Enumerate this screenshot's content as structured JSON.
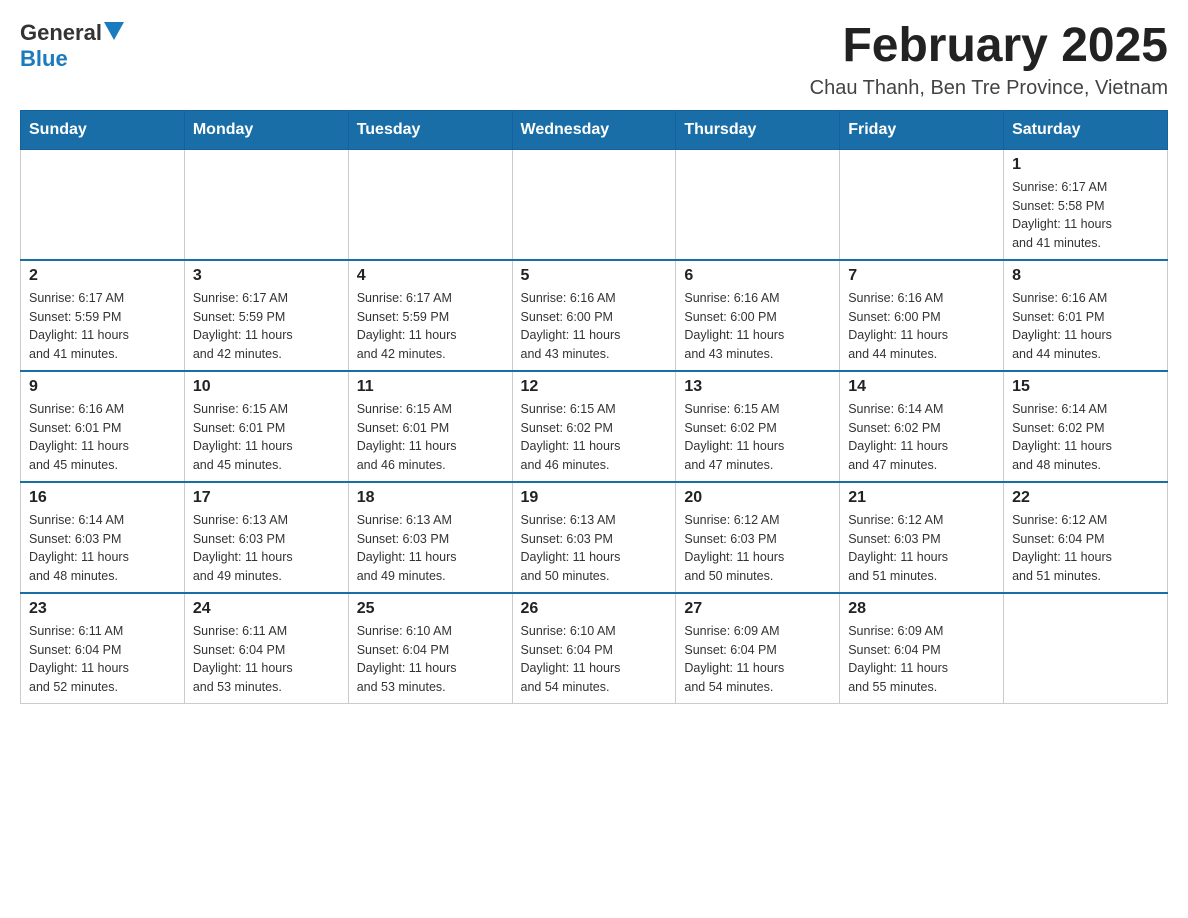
{
  "logo": {
    "general": "General",
    "blue": "Blue"
  },
  "title": "February 2025",
  "subtitle": "Chau Thanh, Ben Tre Province, Vietnam",
  "weekdays": [
    "Sunday",
    "Monday",
    "Tuesday",
    "Wednesday",
    "Thursday",
    "Friday",
    "Saturday"
  ],
  "weeks": [
    [
      {
        "day": "",
        "info": ""
      },
      {
        "day": "",
        "info": ""
      },
      {
        "day": "",
        "info": ""
      },
      {
        "day": "",
        "info": ""
      },
      {
        "day": "",
        "info": ""
      },
      {
        "day": "",
        "info": ""
      },
      {
        "day": "1",
        "info": "Sunrise: 6:17 AM\nSunset: 5:58 PM\nDaylight: 11 hours\nand 41 minutes."
      }
    ],
    [
      {
        "day": "2",
        "info": "Sunrise: 6:17 AM\nSunset: 5:59 PM\nDaylight: 11 hours\nand 41 minutes."
      },
      {
        "day": "3",
        "info": "Sunrise: 6:17 AM\nSunset: 5:59 PM\nDaylight: 11 hours\nand 42 minutes."
      },
      {
        "day": "4",
        "info": "Sunrise: 6:17 AM\nSunset: 5:59 PM\nDaylight: 11 hours\nand 42 minutes."
      },
      {
        "day": "5",
        "info": "Sunrise: 6:16 AM\nSunset: 6:00 PM\nDaylight: 11 hours\nand 43 minutes."
      },
      {
        "day": "6",
        "info": "Sunrise: 6:16 AM\nSunset: 6:00 PM\nDaylight: 11 hours\nand 43 minutes."
      },
      {
        "day": "7",
        "info": "Sunrise: 6:16 AM\nSunset: 6:00 PM\nDaylight: 11 hours\nand 44 minutes."
      },
      {
        "day": "8",
        "info": "Sunrise: 6:16 AM\nSunset: 6:01 PM\nDaylight: 11 hours\nand 44 minutes."
      }
    ],
    [
      {
        "day": "9",
        "info": "Sunrise: 6:16 AM\nSunset: 6:01 PM\nDaylight: 11 hours\nand 45 minutes."
      },
      {
        "day": "10",
        "info": "Sunrise: 6:15 AM\nSunset: 6:01 PM\nDaylight: 11 hours\nand 45 minutes."
      },
      {
        "day": "11",
        "info": "Sunrise: 6:15 AM\nSunset: 6:01 PM\nDaylight: 11 hours\nand 46 minutes."
      },
      {
        "day": "12",
        "info": "Sunrise: 6:15 AM\nSunset: 6:02 PM\nDaylight: 11 hours\nand 46 minutes."
      },
      {
        "day": "13",
        "info": "Sunrise: 6:15 AM\nSunset: 6:02 PM\nDaylight: 11 hours\nand 47 minutes."
      },
      {
        "day": "14",
        "info": "Sunrise: 6:14 AM\nSunset: 6:02 PM\nDaylight: 11 hours\nand 47 minutes."
      },
      {
        "day": "15",
        "info": "Sunrise: 6:14 AM\nSunset: 6:02 PM\nDaylight: 11 hours\nand 48 minutes."
      }
    ],
    [
      {
        "day": "16",
        "info": "Sunrise: 6:14 AM\nSunset: 6:03 PM\nDaylight: 11 hours\nand 48 minutes."
      },
      {
        "day": "17",
        "info": "Sunrise: 6:13 AM\nSunset: 6:03 PM\nDaylight: 11 hours\nand 49 minutes."
      },
      {
        "day": "18",
        "info": "Sunrise: 6:13 AM\nSunset: 6:03 PM\nDaylight: 11 hours\nand 49 minutes."
      },
      {
        "day": "19",
        "info": "Sunrise: 6:13 AM\nSunset: 6:03 PM\nDaylight: 11 hours\nand 50 minutes."
      },
      {
        "day": "20",
        "info": "Sunrise: 6:12 AM\nSunset: 6:03 PM\nDaylight: 11 hours\nand 50 minutes."
      },
      {
        "day": "21",
        "info": "Sunrise: 6:12 AM\nSunset: 6:03 PM\nDaylight: 11 hours\nand 51 minutes."
      },
      {
        "day": "22",
        "info": "Sunrise: 6:12 AM\nSunset: 6:04 PM\nDaylight: 11 hours\nand 51 minutes."
      }
    ],
    [
      {
        "day": "23",
        "info": "Sunrise: 6:11 AM\nSunset: 6:04 PM\nDaylight: 11 hours\nand 52 minutes."
      },
      {
        "day": "24",
        "info": "Sunrise: 6:11 AM\nSunset: 6:04 PM\nDaylight: 11 hours\nand 53 minutes."
      },
      {
        "day": "25",
        "info": "Sunrise: 6:10 AM\nSunset: 6:04 PM\nDaylight: 11 hours\nand 53 minutes."
      },
      {
        "day": "26",
        "info": "Sunrise: 6:10 AM\nSunset: 6:04 PM\nDaylight: 11 hours\nand 54 minutes."
      },
      {
        "day": "27",
        "info": "Sunrise: 6:09 AM\nSunset: 6:04 PM\nDaylight: 11 hours\nand 54 minutes."
      },
      {
        "day": "28",
        "info": "Sunrise: 6:09 AM\nSunset: 6:04 PM\nDaylight: 11 hours\nand 55 minutes."
      },
      {
        "day": "",
        "info": ""
      }
    ]
  ]
}
